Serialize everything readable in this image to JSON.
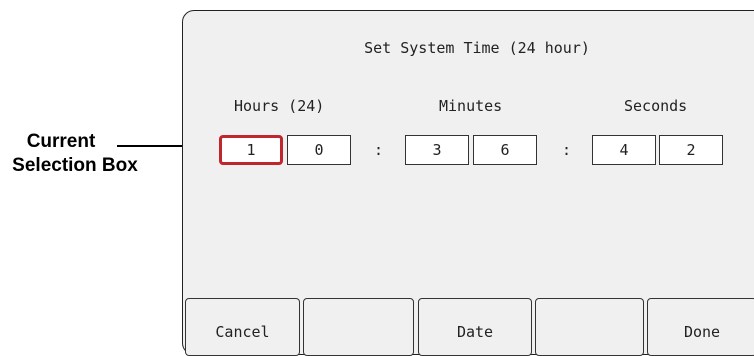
{
  "callout": {
    "line1": "Current",
    "line2": "Selection Box"
  },
  "screen": {
    "title": "Set System Time (24 hour)",
    "columns": [
      {
        "label": "Hours (24)",
        "digits": [
          "1",
          "0"
        ]
      },
      {
        "label": "Minutes",
        "digits": [
          "3",
          "6"
        ]
      },
      {
        "label": "Seconds",
        "digits": [
          "4",
          "2"
        ]
      }
    ],
    "separator": ":",
    "selection_color": "#c0262d",
    "softkeys": [
      "Cancel",
      "",
      "Date",
      "",
      "Done"
    ]
  }
}
